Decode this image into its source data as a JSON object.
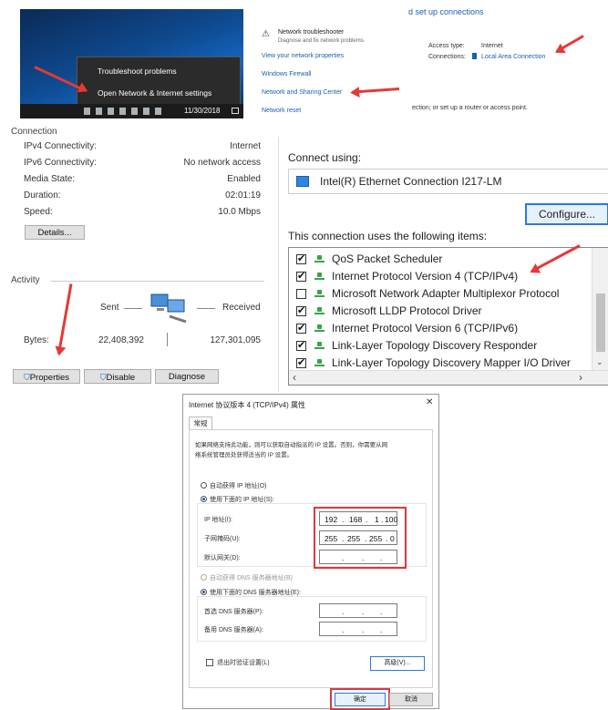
{
  "desktop": {
    "menu_items": [
      "Troubleshoot problems",
      "Open Network & Internet settings"
    ],
    "clock": "11/30/2018"
  },
  "network_status": {
    "troubleshooter_title": "Network troubleshooter",
    "troubleshooter_desc": "Diagnose and fix network problems.",
    "links": [
      "View your network properties",
      "Windows Firewall",
      "Network and Sharing Center",
      "Network reset"
    ]
  },
  "sharing_center": {
    "top_link": "d set up connections",
    "access_type_label": "Access type:",
    "access_type_value": "Internet",
    "connections_label": "Connections:",
    "connections_value": "Local Area Connection",
    "bottom_text": "ection; or set up a router or access point."
  },
  "status": {
    "section_connection": "Connection",
    "rows": [
      {
        "label": "IPv4 Connectivity:",
        "value": "Internet"
      },
      {
        "label": "IPv6 Connectivity:",
        "value": "No network access"
      },
      {
        "label": "Media State:",
        "value": "Enabled"
      },
      {
        "label": "Duration:",
        "value": "02:01:19"
      },
      {
        "label": "Speed:",
        "value": "10.0 Mbps"
      }
    ],
    "details_btn": "Details...",
    "section_activity": "Activity",
    "sent_label": "Sent",
    "received_label": "Received",
    "bytes_label": "Bytes:",
    "bytes_sent": "22,408,392",
    "bytes_received": "127,301,095",
    "btn_properties": "Properties",
    "btn_disable": "Disable",
    "btn_diagnose": "Diagnose"
  },
  "properties": {
    "connect_using_label": "Connect using:",
    "adapter": "Intel(R) Ethernet Connection I217-LM",
    "configure_btn": "Configure...",
    "items_label": "This connection uses the following items:",
    "items": [
      {
        "name": "QoS Packet Scheduler",
        "checked": true
      },
      {
        "name": "Internet Protocol Version 4 (TCP/IPv4)",
        "checked": true
      },
      {
        "name": "Microsoft Network Adapter Multiplexor Protocol",
        "checked": false
      },
      {
        "name": "Microsoft LLDP Protocol Driver",
        "checked": true
      },
      {
        "name": "Internet Protocol Version 6 (TCP/IPv6)",
        "checked": true
      },
      {
        "name": "Link-Layer Topology Discovery Responder",
        "checked": true
      },
      {
        "name": "Link-Layer Topology Discovery Mapper I/O Driver",
        "checked": true
      }
    ]
  },
  "ipv4_dialog": {
    "title": "Internet 协议版本 4 (TCP/IPv4) 属性",
    "tab": "常规",
    "desc_line1": "如果网络支持此功能，则可以获取自动指派的 IP 设置。否则，你需要从网",
    "desc_line2": "络系统管理员处获得适当的 IP 设置。",
    "auto_ip": "自动获得 IP 地址(O)",
    "manual_ip": "使用下面的 IP 地址(S):",
    "ip_label": "IP 地址(I):",
    "mask_label": "子网掩码(U):",
    "gateway_label": "默认网关(D):",
    "ip_octets": [
      "192",
      "168",
      "1",
      "100"
    ],
    "mask_octets": [
      "255",
      "255",
      "255",
      "0"
    ],
    "auto_dns": "自动获得 DNS 服务器地址(B)",
    "manual_dns": "使用下面的 DNS 服务器地址(E):",
    "dns1_label": "首选 DNS 服务器(P):",
    "dns2_label": "备用 DNS 服务器(A):",
    "validate": "退出时验证设置(L)",
    "advanced_btn": "高级(V)...",
    "ok_btn": "确定",
    "cancel_btn": "取消"
  },
  "colors": {
    "accent": "#1a5fb4",
    "arrow": "#e53935",
    "highlight_box": "#d9393f"
  }
}
